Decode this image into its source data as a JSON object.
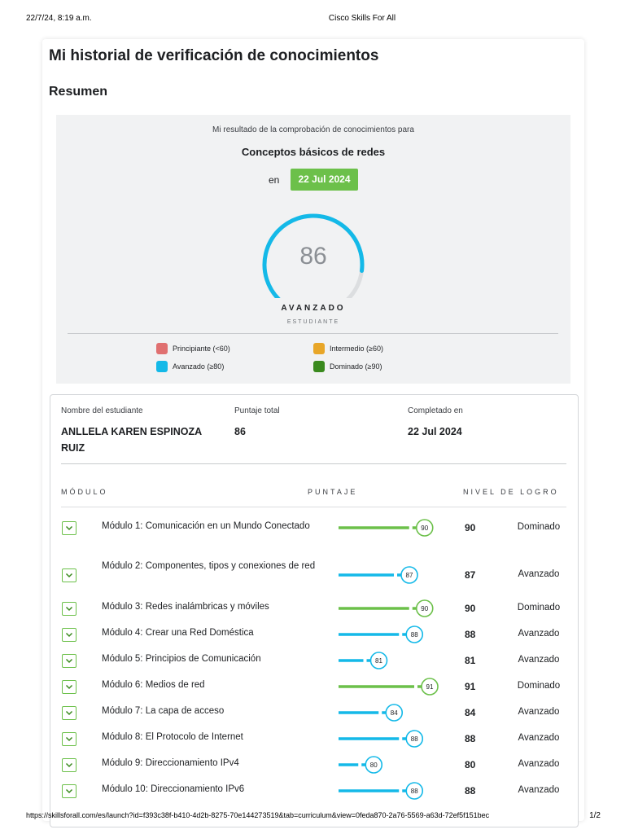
{
  "print": {
    "datetime": "22/7/24, 8:19 a.m.",
    "site_title": "Cisco Skills For All",
    "url": "https://skillsforall.com/es/launch?id=f393c38f-b410-4d2b-8275-70e144273519&tab=curriculum&view=0feda870-2a76-5569-a63d-72ef5f151bec",
    "page_count": "1/2"
  },
  "page": {
    "title": "Mi historial de verificación de conocimientos",
    "section": "Resumen"
  },
  "summary": {
    "intro": "Mi resultado de la comprobación de conocimientos para",
    "course": "Conceptos básicos de redes",
    "on_label": "en",
    "date": "22 Jul 2024",
    "score": "86",
    "score_value": 86,
    "level": "AVANZADO",
    "role": "ESTUDIANTE",
    "legend": [
      {
        "label": "Principiante (<60)",
        "color": "#e07070"
      },
      {
        "label": "Intermedio (≥60)",
        "color": "#e8a628"
      },
      {
        "label": "Avanzado (≥80)",
        "color": "#14b9e8"
      },
      {
        "label": "Dominado (≥90)",
        "color": "#3a8a1e"
      }
    ]
  },
  "details": {
    "student_label": "Nombre del estudiante",
    "student_name": "ANLLELA KAREN ESPINOZA RUIZ",
    "total_label": "Puntaje total",
    "total_value": "86",
    "completed_label": "Completado en",
    "completed_value": "22 Jul 2024",
    "col_module": "MÓDULO",
    "col_score": "PUNTAJE",
    "col_level": "NIVEL DE LOGRO"
  },
  "colors": {
    "dominado": "#6cc04a",
    "avanzado": "#14b9e8",
    "gauge_track": "#dcdee0"
  },
  "modules": [
    {
      "name": "Módulo 1: Comunicación en un Mundo Conectado",
      "score": 90,
      "score_text": "90",
      "level": "Dominado"
    },
    {
      "name": "Módulo 2: Componentes, tipos y conexiones de red",
      "score": 87,
      "score_text": "87",
      "level": "Avanzado"
    },
    {
      "name": "Módulo 3: Redes inalámbricas y móviles",
      "score": 90,
      "score_text": "90",
      "level": "Dominado"
    },
    {
      "name": "Módulo 4: Crear una Red Doméstica",
      "score": 88,
      "score_text": "88",
      "level": "Avanzado"
    },
    {
      "name": "Módulo 5: Principios de Comunicación",
      "score": 81,
      "score_text": "81",
      "level": "Avanzado"
    },
    {
      "name": "Módulo 6: Medios de red",
      "score": 91,
      "score_text": "91",
      "level": "Dominado"
    },
    {
      "name": "Módulo 7: La capa de acceso",
      "score": 84,
      "score_text": "84",
      "level": "Avanzado"
    },
    {
      "name": "Módulo 8: El Protocolo de Internet",
      "score": 88,
      "score_text": "88",
      "level": "Avanzado"
    },
    {
      "name": "Módulo 9: Direccionamiento IPv4",
      "score": 80,
      "score_text": "80",
      "level": "Avanzado"
    },
    {
      "name": "Módulo 10: Direccionamiento IPv6",
      "score": 88,
      "score_text": "88",
      "level": "Avanzado"
    }
  ]
}
